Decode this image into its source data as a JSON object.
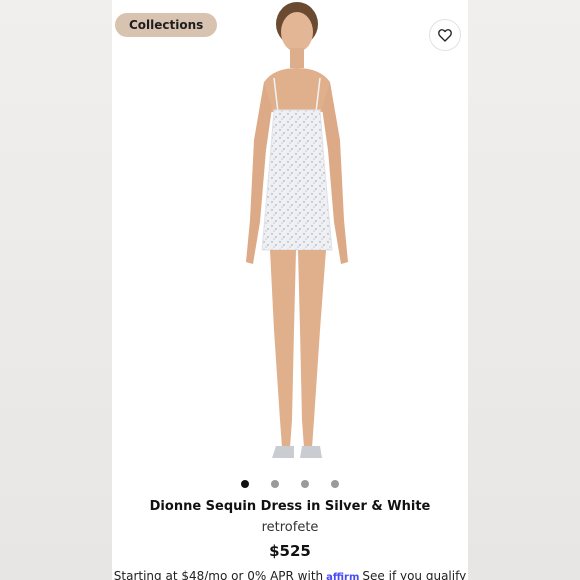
{
  "header": {
    "collections_label": "Collections",
    "favorite_icon": "heart-outline-icon"
  },
  "gallery": {
    "image_count": 4,
    "active_index": 0
  },
  "product": {
    "title": "Dionne Sequin Dress in Silver & White",
    "brand": "retrofete",
    "price": "$525"
  },
  "financing": {
    "text": "Starting at $48/mo or 0% APR with",
    "provider": "affirm",
    "link": "See if you qualify"
  },
  "colors": {
    "collections_bg": "#d8c3b0",
    "dot_active": "#111111",
    "dot_inactive": "#9a9a9a",
    "affirm_brand": "#4a4af4"
  }
}
